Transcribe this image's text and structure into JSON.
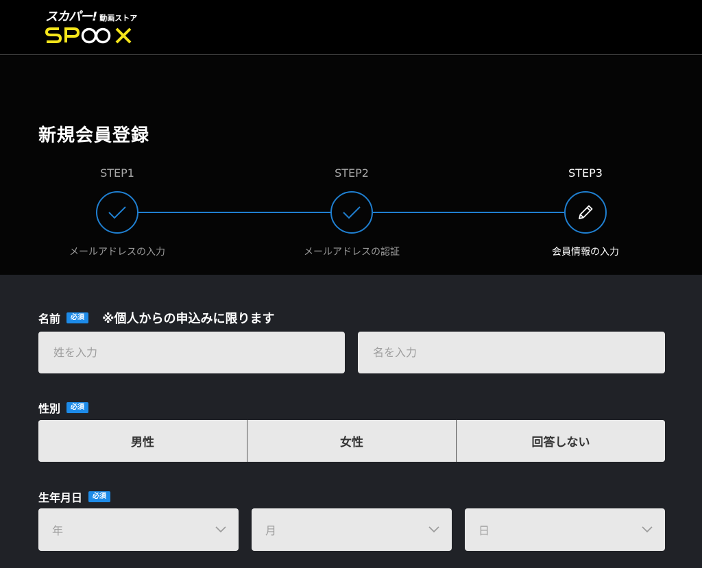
{
  "header": {
    "logo_top": "スカパー!",
    "logo_store": "動画ストア",
    "logo_main": "SPOOX"
  },
  "page": {
    "title": "新規会員登録"
  },
  "steps": [
    {
      "label": "STEP1",
      "caption": "メールアドレスの入力",
      "icon": "checkmark-icon",
      "active": false
    },
    {
      "label": "STEP2",
      "caption": "メールアドレスの認証",
      "icon": "checkmark-icon",
      "active": false
    },
    {
      "label": "STEP3",
      "caption": "会員情報の入力",
      "icon": "pencil-icon",
      "active": true
    }
  ],
  "form": {
    "required_badge": "必須",
    "name": {
      "label": "名前",
      "note": "※個人からの申込みに限ります",
      "last_placeholder": "姓を入力",
      "first_placeholder": "名を入力"
    },
    "gender": {
      "label": "性別",
      "options": [
        "男性",
        "女性",
        "回答しない"
      ]
    },
    "birthday": {
      "label": "生年月日",
      "year": "年",
      "month": "月",
      "day": "日"
    }
  },
  "colors": {
    "accent": "#1f7fd0",
    "badge": "#1d8be8",
    "logo_yellow": "#f5e51b",
    "form_bg": "#202227",
    "input_bg": "#e8e8e8"
  }
}
